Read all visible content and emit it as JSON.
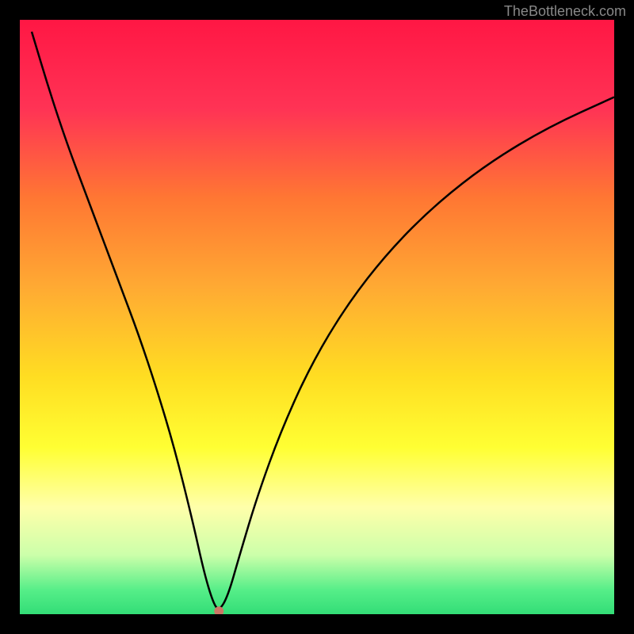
{
  "watermark": "TheBottleneck.com",
  "chart_data": {
    "type": "line",
    "title": "",
    "xlabel": "",
    "ylabel": "",
    "xlim": [
      0,
      100
    ],
    "ylim": [
      0,
      100
    ],
    "background_gradient": {
      "stops": [
        {
          "offset": 0,
          "color": "#ff1744"
        },
        {
          "offset": 15,
          "color": "#ff3355"
        },
        {
          "offset": 30,
          "color": "#ff7733"
        },
        {
          "offset": 45,
          "color": "#ffaa33"
        },
        {
          "offset": 60,
          "color": "#ffdd22"
        },
        {
          "offset": 72,
          "color": "#ffff33"
        },
        {
          "offset": 82,
          "color": "#ffffaa"
        },
        {
          "offset": 90,
          "color": "#ccffaa"
        },
        {
          "offset": 96,
          "color": "#55ee88"
        },
        {
          "offset": 100,
          "color": "#33dd77"
        }
      ]
    },
    "curve": {
      "description": "V-shaped bottleneck curve with minimum near x=33",
      "x": [
        2,
        5,
        8,
        11,
        14,
        17,
        20,
        23,
        26,
        29,
        31,
        32.5,
        33.5,
        35,
        37,
        40,
        44,
        49,
        55,
        62,
        70,
        79,
        89,
        100
      ],
      "y": [
        98,
        88,
        79,
        71,
        63,
        55,
        47,
        38,
        28,
        16,
        7,
        2,
        0.5,
        3,
        10,
        20,
        31,
        42,
        52,
        61,
        69,
        76,
        82,
        87
      ],
      "stroke": "#000000",
      "stroke_width": 2.5
    },
    "marker": {
      "x": 33.5,
      "y": 0.5,
      "radius": 6,
      "color": "#cc7766"
    }
  }
}
